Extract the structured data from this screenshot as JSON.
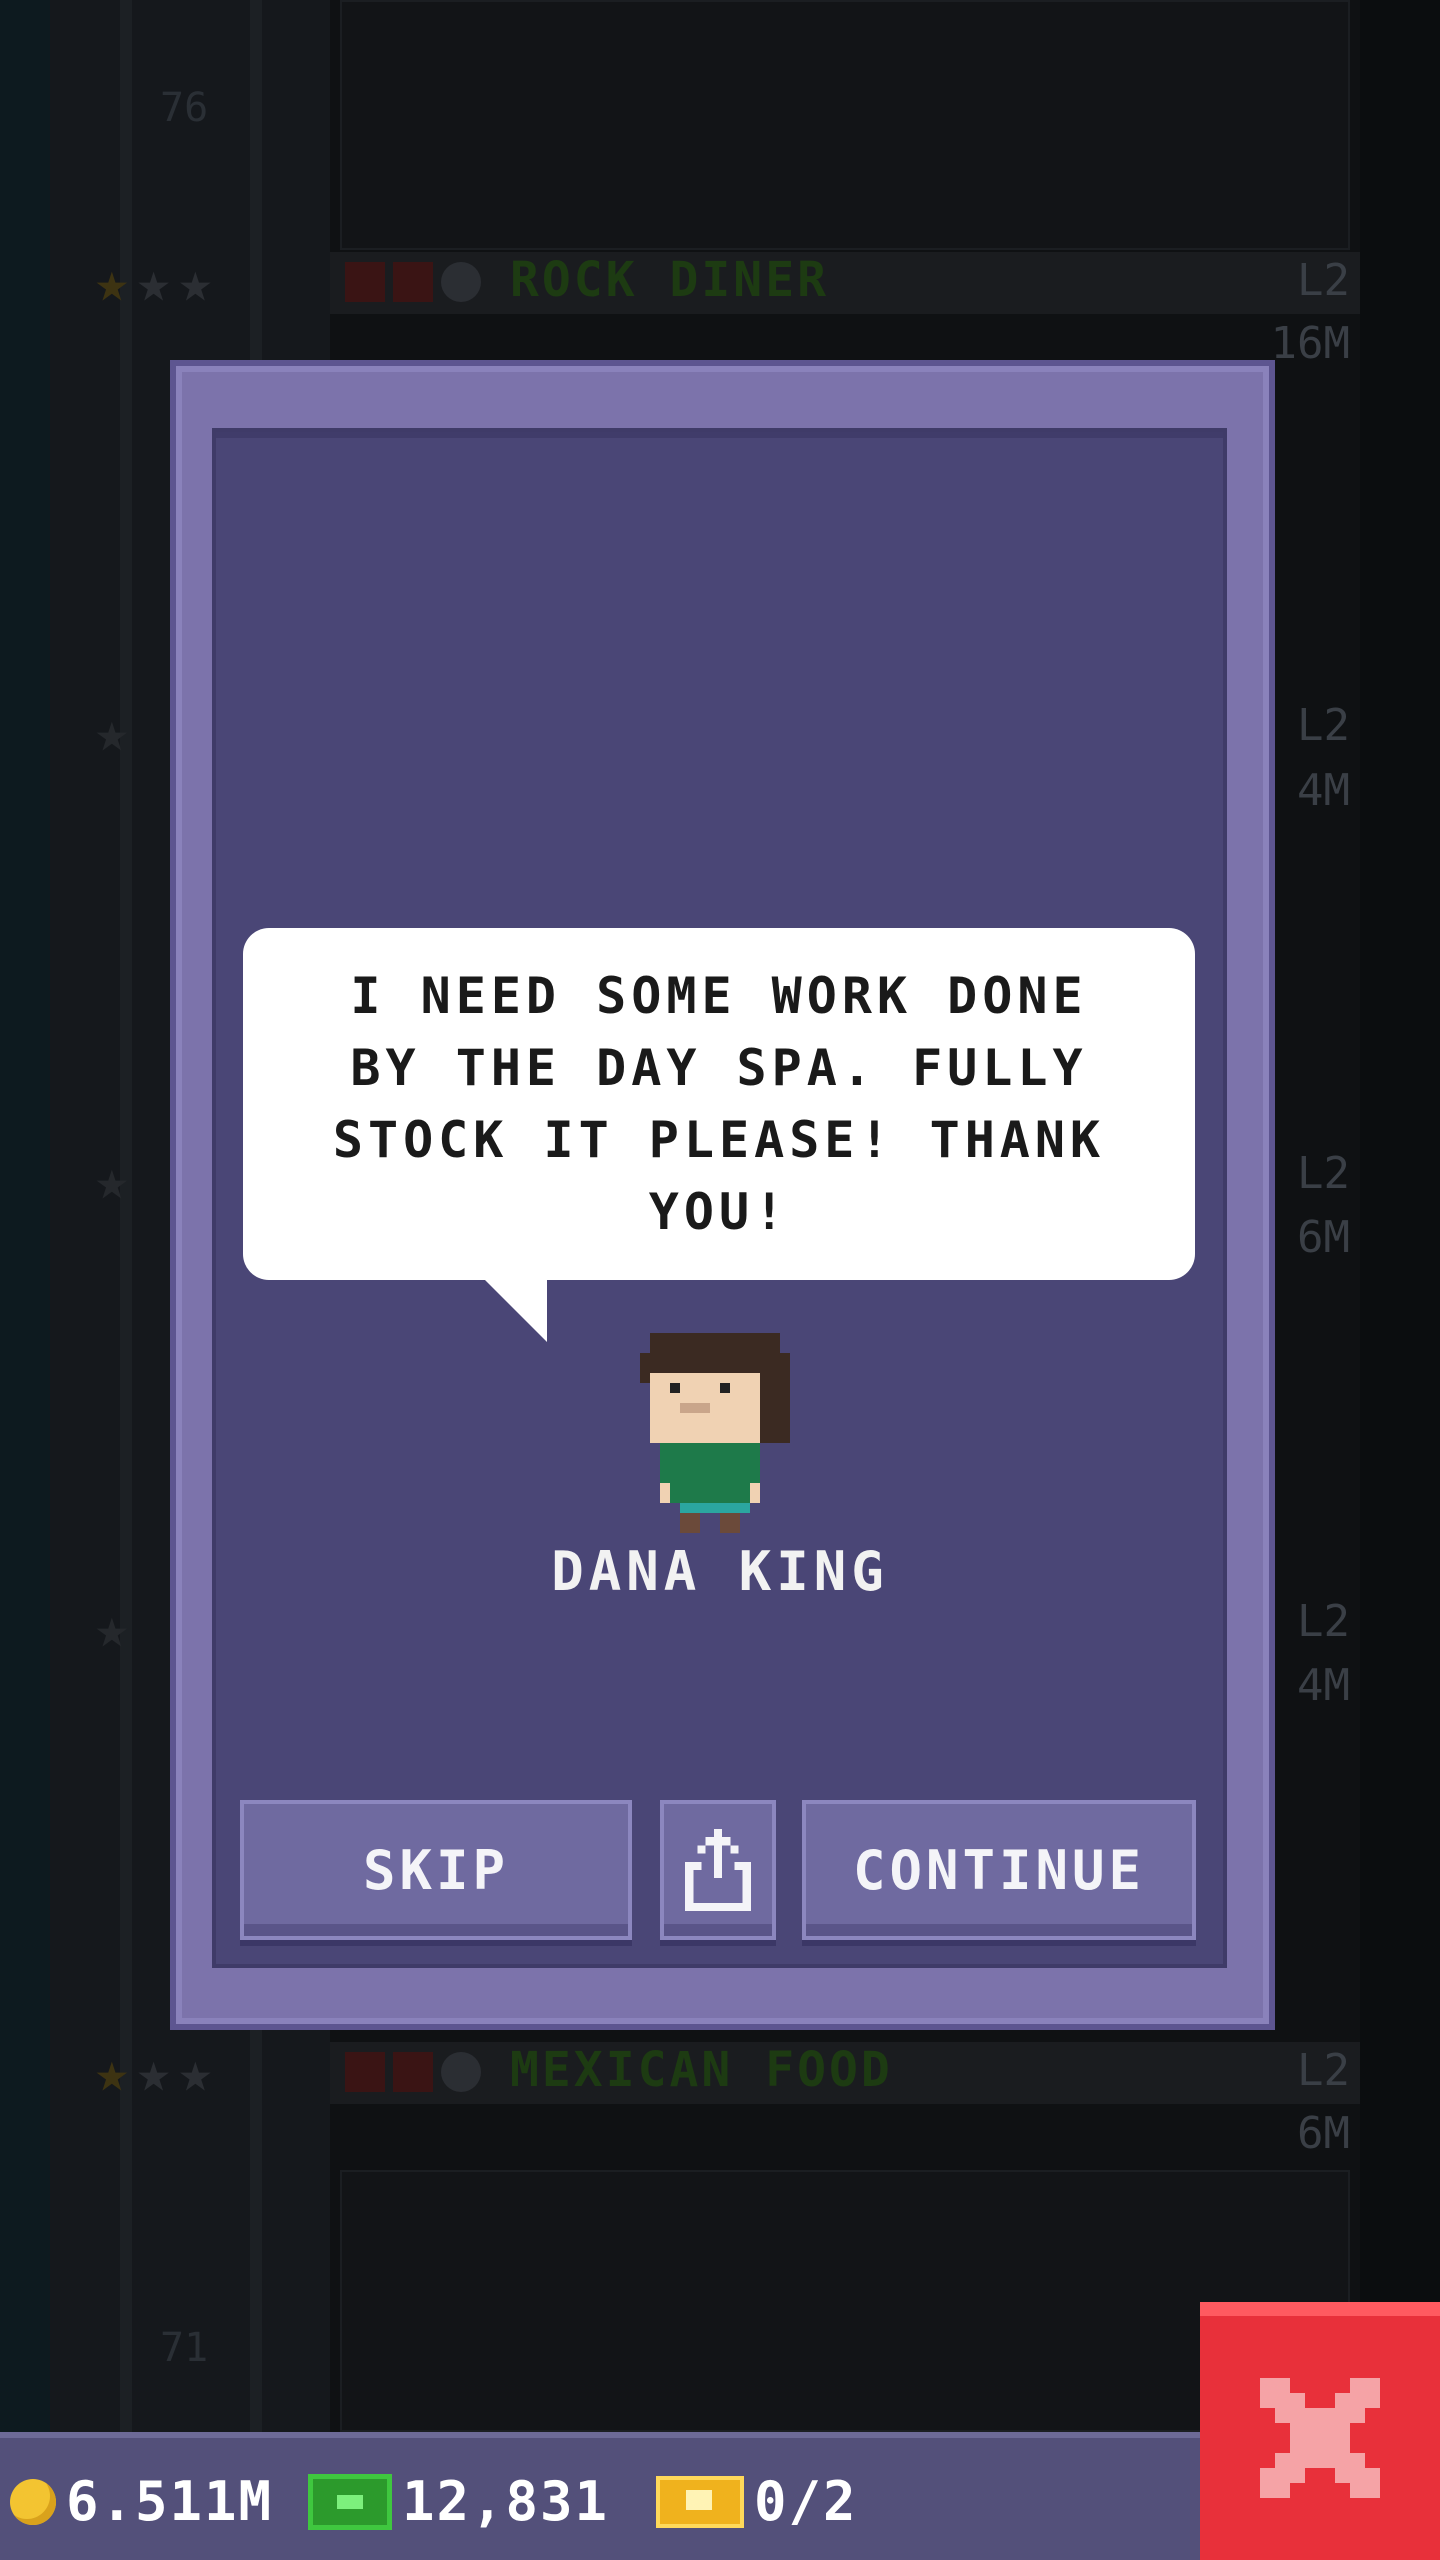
{
  "background": {
    "floors": [
      {
        "name": "ROCK DINER",
        "level": "L2",
        "cost": "16M",
        "floor_number": "76"
      },
      {
        "name": "",
        "level": "L2",
        "cost": "4M"
      },
      {
        "name": "",
        "level": "L2",
        "cost": "6M"
      },
      {
        "name": "",
        "level": "L2",
        "cost": "4M"
      },
      {
        "name": "MEXICAN FOOD",
        "level": "L2",
        "cost": "6M",
        "floor_number": "71"
      }
    ]
  },
  "dialog": {
    "message": "I NEED SOME WORK DONE BY THE DAY SPA. FULLY STOCK IT PLEASE! THANK YOU!",
    "character_name": "DANA KING",
    "buttons": {
      "skip": "SKIP",
      "share_icon": "share-icon",
      "continue": "CONTINUE"
    }
  },
  "hud": {
    "coins": "6.511M",
    "bux": "12,831",
    "tickets": "0/2"
  },
  "colors": {
    "modal_frame": "#7c73ab",
    "modal_inner": "#4a4676",
    "close_button": "#e8303a",
    "floor_name_green": "#1d3b12"
  }
}
